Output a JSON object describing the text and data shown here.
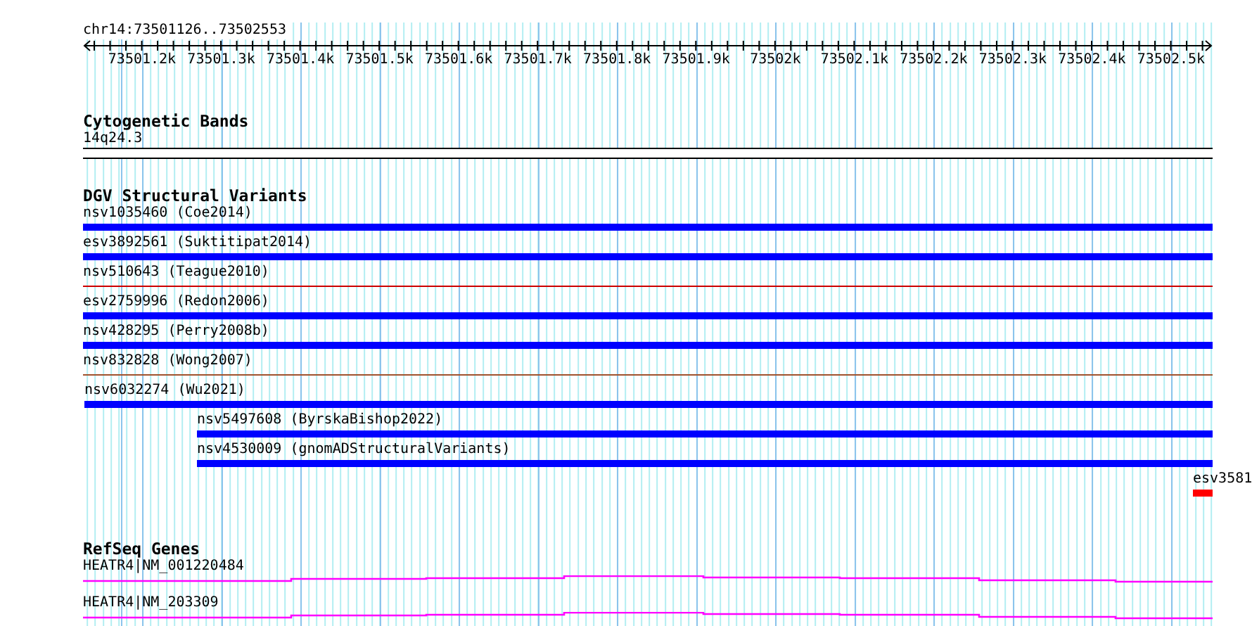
{
  "location": "chr14:73501126..73502553",
  "ruler": {
    "tick_labels": [
      "73501.2k",
      "73501.3k",
      "73501.4k",
      "73501.5k",
      "73501.6k",
      "73501.7k",
      "73501.8k",
      "73501.9k",
      "73502k",
      "73502.1k",
      "73502.2k",
      "73502.3k",
      "73502.4k",
      "73502.5k"
    ]
  },
  "cytoband_track": {
    "title": "Cytogenetic Bands",
    "band": "14q24.3"
  },
  "dgv_track": {
    "title": "DGV Structural Variants",
    "features": [
      {
        "label": "nsv1035460 (Coe2014)",
        "kind": "bar",
        "color": "#0000ff"
      },
      {
        "label": "esv3892561 (Suktitipat2014)",
        "kind": "bar",
        "color": "#0000ff"
      },
      {
        "label": "nsv510643 (Teague2010)",
        "kind": "line",
        "color": "#cc0000"
      },
      {
        "label": "esv2759996 (Redon2006)",
        "kind": "bar",
        "color": "#0000ff"
      },
      {
        "label": "nsv428295 (Perry2008b)",
        "kind": "bar",
        "color": "#0000ff"
      },
      {
        "label": "nsv832828 (Wong2007)",
        "kind": "line",
        "color": "#a0522d"
      },
      {
        "label": "nsv6032274 (Wu2021)",
        "kind": "bar",
        "color": "#0000ff"
      },
      {
        "label": "nsv5497608 (ByrskaBishop2022)",
        "kind": "bar",
        "color": "#0000ff"
      },
      {
        "label": "nsv4530009 (gnomADStructuralVariants)",
        "kind": "bar",
        "color": "#0000ff"
      },
      {
        "label": "esv3581",
        "kind": "bar",
        "color": "#ff0000"
      }
    ]
  },
  "refseq_track": {
    "title": "RefSeq Genes",
    "genes": [
      {
        "label": "HEATR4|NM_001220484"
      },
      {
        "label": "HEATR4|NM_203309"
      }
    ]
  }
}
